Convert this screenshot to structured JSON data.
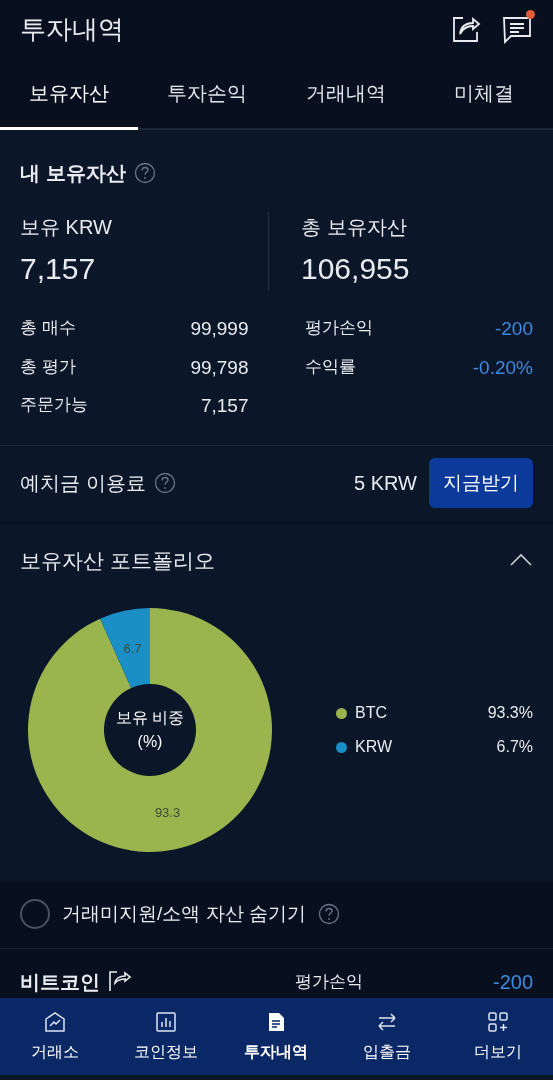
{
  "header": {
    "title": "투자내역",
    "notification_dot": true
  },
  "tabs": [
    {
      "label": "보유자산",
      "selected": true
    },
    {
      "label": "투자손익",
      "selected": false
    },
    {
      "label": "거래내역",
      "selected": false
    },
    {
      "label": "미체결",
      "selected": false
    }
  ],
  "holdings": {
    "title": "내 보유자산",
    "krw_label": "보유 KRW",
    "krw_value": "7,157",
    "total_label": "총 보유자산",
    "total_value": "106,955",
    "left_rows": [
      {
        "label": "총 매수",
        "value": "99,999"
      },
      {
        "label": "총 평가",
        "value": "99,798"
      },
      {
        "label": "주문가능",
        "value": "7,157"
      }
    ],
    "right_rows": [
      {
        "label": "평가손익",
        "value": "-200",
        "negative": true
      },
      {
        "label": "수익률",
        "value": "-0.20%",
        "negative": true
      }
    ]
  },
  "deposit_fee": {
    "label": "예치금 이용료",
    "amount": "5 KRW",
    "button": "지금받기"
  },
  "portfolio": {
    "title": "보유자산 포트폴리오",
    "expanded": true,
    "center_label": "보유 비중",
    "center_unit": "(%)",
    "chart_data": {
      "type": "donut",
      "categories": [
        "BTC",
        "KRW"
      ],
      "values": [
        93.3,
        6.7
      ],
      "data_labels": true
    },
    "legend": [
      {
        "percent": "93.3%",
        "color": "#9bb54e"
      },
      {
        "percent": "6.7%",
        "color": "#1a8fc6"
      }
    ]
  },
  "hide_small": {
    "label": "거래미지원/소액 자산 숨기기",
    "checked": false
  },
  "coin_row": {
    "name": "비트코인",
    "pnl_label": "평가손익",
    "pnl_value": "-200"
  },
  "bottom_nav": [
    {
      "label": "거래소",
      "kind": "exchange",
      "selected": false
    },
    {
      "label": "코인정보",
      "kind": "chart",
      "selected": false
    },
    {
      "label": "투자내역",
      "kind": "doc",
      "selected": true
    },
    {
      "label": "입출금",
      "kind": "transfer",
      "selected": false
    },
    {
      "label": "더보기",
      "kind": "more",
      "selected": false
    }
  ]
}
